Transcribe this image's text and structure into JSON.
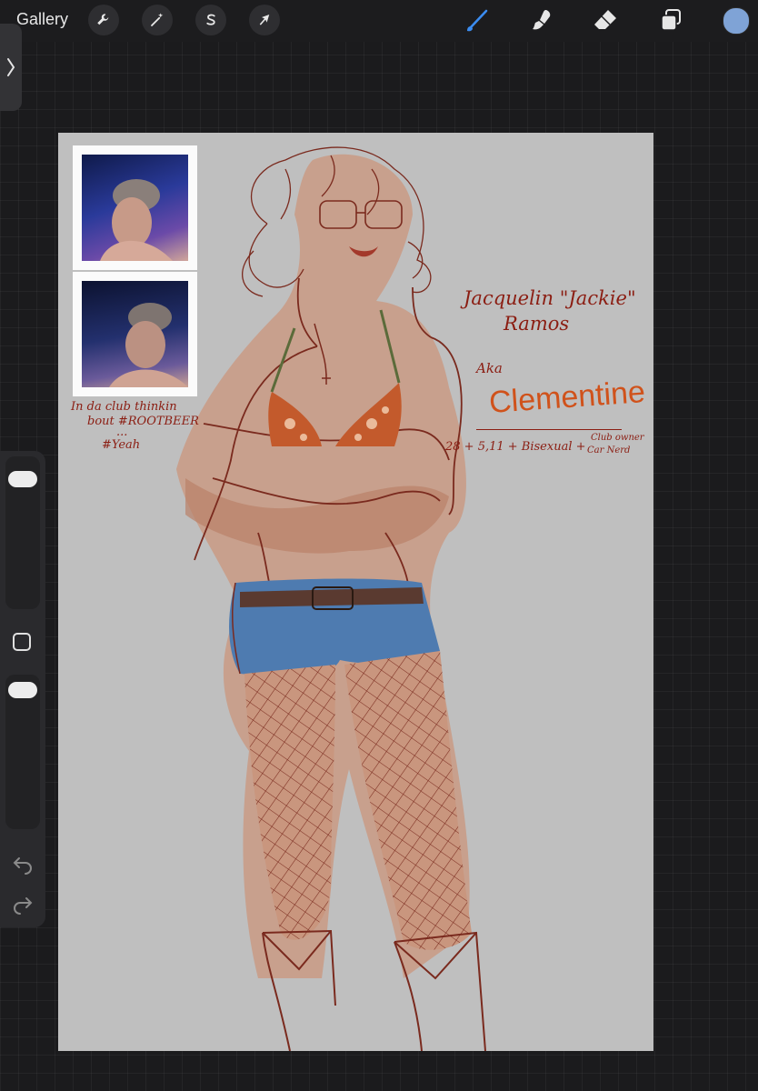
{
  "app": {
    "gallery_label": "Gallery",
    "active_color": "#7fa3d6"
  },
  "toolbar": {
    "left_tools": [
      {
        "name": "actions",
        "icon": "wrench-icon"
      },
      {
        "name": "adjustments",
        "icon": "magic-wand-icon"
      },
      {
        "name": "selection",
        "icon": "selection-s-icon"
      },
      {
        "name": "transform",
        "icon": "arrow-cursor-icon"
      }
    ],
    "right_tools": [
      {
        "name": "brush",
        "icon": "brush-icon",
        "active": true,
        "color": "#3b8cf0"
      },
      {
        "name": "smudge",
        "icon": "smudge-icon"
      },
      {
        "name": "eraser",
        "icon": "eraser-icon"
      },
      {
        "name": "layers",
        "icon": "layers-icon"
      }
    ]
  },
  "sidebar": {
    "brush_size_icon": "slider-thumb",
    "modify_icon": "square-icon",
    "undo_icon": "undo-icon",
    "redo_icon": "redo-icon"
  },
  "artwork": {
    "photo_caption_line1": "In da club thinkin",
    "photo_caption_line2": "bout #ROOTBEER",
    "photo_caption_dots": "...",
    "photo_caption_line3": "#Yeah",
    "name_line1": "Jacquelin \"Jackie\"",
    "name_line2": "Ramos",
    "aka": "Aka",
    "alias": "Clementine",
    "facts": "28 + 5,11 + Bisexual +",
    "facts_extra_line1": "Club owner",
    "facts_extra_line2": "Car Nerd"
  }
}
